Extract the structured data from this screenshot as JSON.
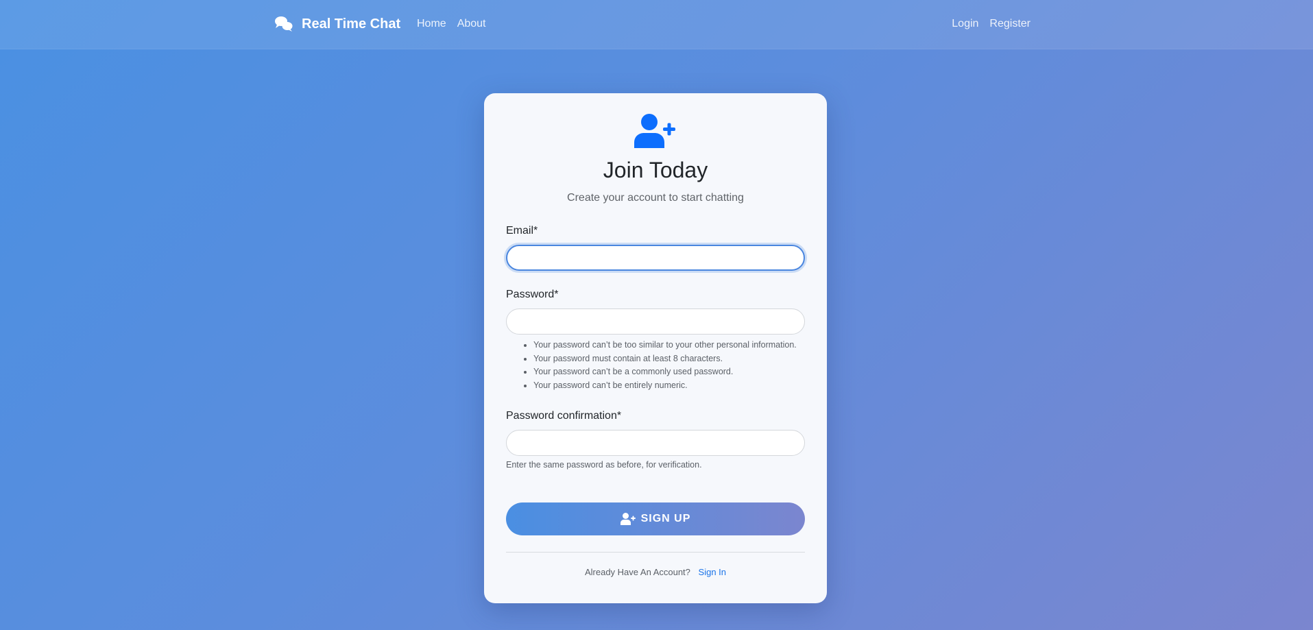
{
  "navbar": {
    "brand": "Real Time Chat",
    "brand_icon": "chat-bubbles-icon",
    "left_links": [
      "Home",
      "About"
    ],
    "right_links": [
      "Login",
      "Register"
    ]
  },
  "card": {
    "icon": "user-plus-icon",
    "title": "Join Today",
    "subtitle": "Create your account to start chatting"
  },
  "form": {
    "email": {
      "label": "Email*",
      "value": ""
    },
    "password": {
      "label": "Password*",
      "value": "",
      "help": [
        "Your password can’t be too similar to your other personal information.",
        "Your password must contain at least 8 characters.",
        "Your password can’t be a commonly used password.",
        "Your password can’t be entirely numeric."
      ]
    },
    "password_confirmation": {
      "label": "Password confirmation*",
      "value": "",
      "help": "Enter the same password as before, for verification."
    },
    "submit_label": "SIGN UP",
    "submit_icon": "user-plus-icon"
  },
  "footer": {
    "prompt": "Already Have An Account?",
    "link": "Sign In"
  },
  "colors": {
    "accent": "#0d6efd",
    "link": "#1a73e8",
    "background_start": "#4a90e2",
    "background_end": "#7b86cf"
  }
}
